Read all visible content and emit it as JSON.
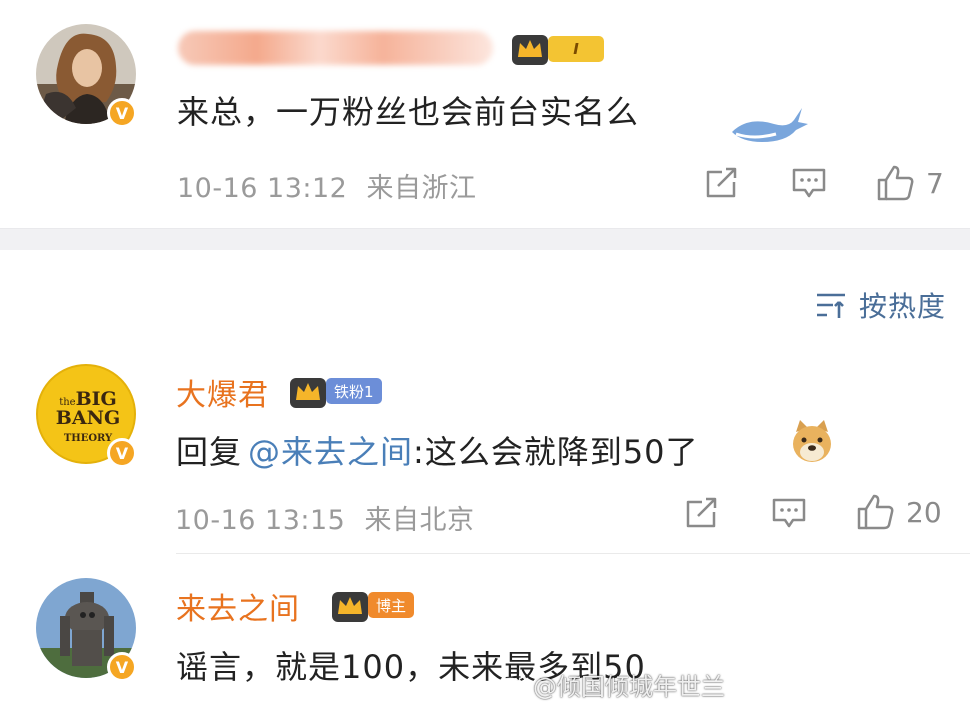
{
  "comments": [
    {
      "username_label": "",
      "text": "来总，一万粉丝也会前台实名么",
      "date": "10-16 13:12",
      "location": "来自浙江",
      "likes": "7",
      "rank_badge": "I",
      "avatar_icon": "woman-portrait-avatar"
    },
    {
      "username": "大爆君",
      "rank_badge": "铁粉1",
      "reply_prefix": "回复",
      "mention": "@来去之间",
      "text": ":这么会就降到50了",
      "date": "10-16 13:15",
      "location": "来自北京",
      "likes": "20",
      "avatar_text": [
        "the",
        "BIG",
        "BANG",
        "THEORY"
      ],
      "avatar_icon": "big-bang-theory-logo-avatar"
    },
    {
      "username": "来去之间",
      "rank_badge": "博主",
      "text": "谣言，就是100，未来最多到50",
      "avatar_icon": "robot-statue-avatar"
    }
  ],
  "sort": {
    "label": "按热度",
    "icon": "sort-icon"
  },
  "watermark": {
    "text": "@倾国倾城年世兰",
    "icon": "weibo-logo-icon"
  },
  "verified_badge": "V",
  "colors": {
    "username": "#e8731f",
    "mention": "#4a7fb8",
    "meta": "#9a9a9a",
    "badge_orange": "#f5a623",
    "sort_blue": "#4a6e98"
  }
}
